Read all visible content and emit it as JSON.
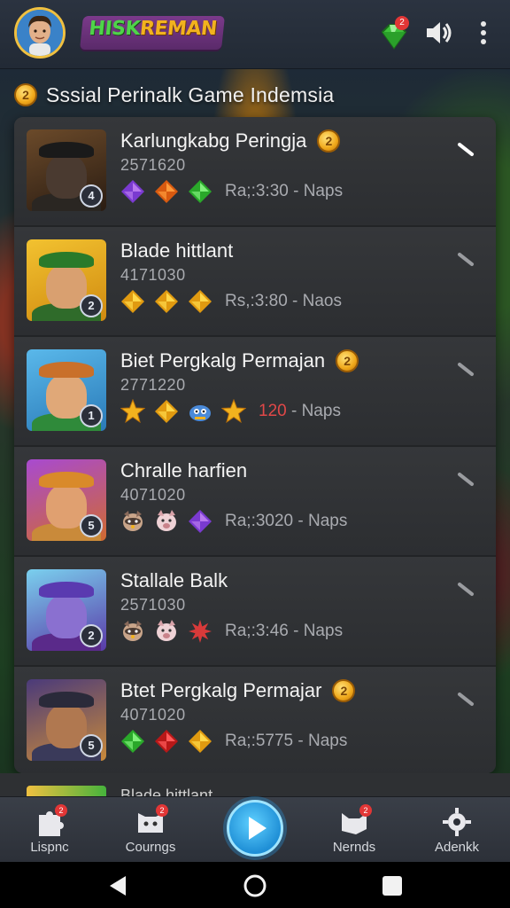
{
  "header": {
    "logo_part1": "HISK",
    "logo_part2": "REMAN",
    "gem_badge": "2"
  },
  "section": {
    "coin_glyph": "2",
    "title": "Sssial Perinalk Game Indemsia"
  },
  "rows": [
    {
      "name": "Karlungkabg Peringja",
      "has_coin": true,
      "coin": "2",
      "id": "2571620",
      "badge": "4",
      "meta_prefix": "",
      "meta": "Ra;:3:30 - Naps",
      "rewards": [
        "gem-purple",
        "gem-orange",
        "gem-green"
      ],
      "colors": {
        "bg1": "#6b4a2a",
        "bg2": "#2a1c12",
        "face": "#4a3a30",
        "hat": "#1a1a1a",
        "body": "#2a2622"
      }
    },
    {
      "name": "Blade hittlant",
      "has_coin": false,
      "id": "4171030",
      "badge": "2",
      "meta_prefix": "",
      "meta": "Rs,:3:80 - Naos",
      "rewards": [
        "gem-gold",
        "gem-gold",
        "gem-gold"
      ],
      "colors": {
        "bg1": "#f2c230",
        "bg2": "#d08a10",
        "face": "#d9a070",
        "hat": "#2a7a2a",
        "body": "#2f6b2a"
      }
    },
    {
      "name": "Biet Pergkalg Permajan",
      "has_coin": true,
      "coin": "2",
      "id": "2771220",
      "badge": "1",
      "meta_prefix": "120",
      "meta": " - Naps",
      "rewards": [
        "star-gold",
        "gem-gold",
        "pet-blue",
        "star-gold"
      ],
      "colors": {
        "bg1": "#5ab8ea",
        "bg2": "#2a7ab8",
        "face": "#e0a878",
        "hat": "#c9702a",
        "body": "#2f8a3a"
      }
    },
    {
      "name": "Chralle harfien",
      "has_coin": false,
      "id": "4071020",
      "badge": "5",
      "meta_prefix": "",
      "meta": "Ra;:3020 - Naps",
      "rewards": [
        "pet-raccoon",
        "pet-pig",
        "gem-purple"
      ],
      "colors": {
        "bg1": "#a84ad0",
        "bg2": "#d06a30",
        "face": "#e0a070",
        "hat": "#d98a2a",
        "body": "#c98a3a"
      }
    },
    {
      "name": "Stallale Balk",
      "has_coin": false,
      "id": "2571030",
      "badge": "2",
      "meta_prefix": "",
      "meta": "Ra;:3:46 - Naps",
      "rewards": [
        "pet-raccoon",
        "pet-pig",
        "burst-red"
      ],
      "colors": {
        "bg1": "#7ad0ee",
        "bg2": "#5a3aa8",
        "face": "#8a70d0",
        "hat": "#5a3ab0",
        "body": "#5a2a8a"
      }
    },
    {
      "name": "Btet Pergkalg Permajar",
      "has_coin": true,
      "coin": "2",
      "id": "4071020",
      "badge": "5",
      "meta_prefix": "",
      "meta": "Ra;:5775 - Naps",
      "rewards": [
        "gem-green",
        "gem-red",
        "gem-gold"
      ],
      "colors": {
        "bg1": "#4a3a7a",
        "bg2": "#c98a3a",
        "face": "#b07850",
        "hat": "#2a2a3a",
        "body": "#3a3a5a"
      }
    }
  ],
  "peek_name": "Blade hittlant",
  "nav": [
    {
      "label": "Lispnc",
      "icon": "star-puzzle-icon",
      "badge": "2"
    },
    {
      "label": "Courngs",
      "icon": "pet-face-icon",
      "badge": "2"
    },
    {
      "label": "Nernds",
      "icon": "cat-puzzle-icon",
      "badge": "2"
    },
    {
      "label": "Adenkk",
      "icon": "gear-puzzle-icon"
    }
  ],
  "gem_colors": {
    "gem-purple": [
      "#b879ee",
      "#7a3ad0"
    ],
    "gem-orange": [
      "#ff9a3a",
      "#d85a10"
    ],
    "gem-green": [
      "#7ff07a",
      "#2aa82a"
    ],
    "gem-gold": [
      "#ffd84a",
      "#e09a10"
    ],
    "gem-red": [
      "#ff5a5a",
      "#b81818"
    ]
  }
}
